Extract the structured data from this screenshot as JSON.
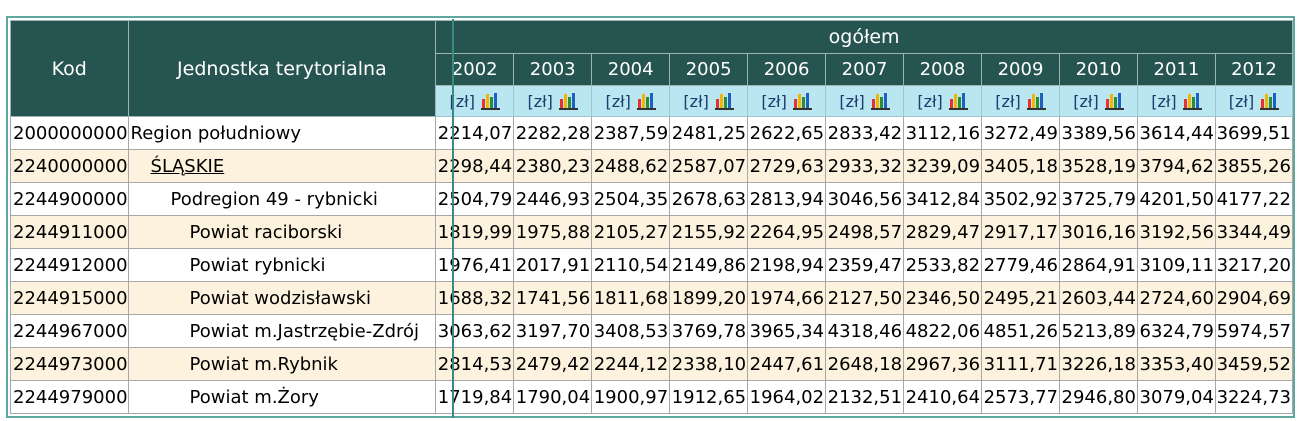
{
  "header": {
    "kod_label": "Kod",
    "jt_label": "Jednostka terytorialna",
    "group_label": "ogółem",
    "years": [
      "2002",
      "2003",
      "2004",
      "2005",
      "2006",
      "2007",
      "2008",
      "2009",
      "2010",
      "2011",
      "2012"
    ],
    "unit_label": "[zł]",
    "chart_icon": "bar-chart-icon"
  },
  "colors": {
    "header_bg": "#265450",
    "unit_row_bg": "#b9e6f0",
    "alt_row_bg": "#fcf2dd",
    "frame": "#5fa8a0"
  },
  "rows": [
    {
      "code": "2000000000",
      "name": "Region południowy",
      "level": 0,
      "link": false,
      "values": [
        "2214,07",
        "2282,28",
        "2387,59",
        "2481,25",
        "2622,65",
        "2833,42",
        "3112,16",
        "3272,49",
        "3389,56",
        "3614,44",
        "3699,51"
      ]
    },
    {
      "code": "2240000000",
      "name": "ŚLĄSKIE",
      "level": 1,
      "link": true,
      "values": [
        "2298,44",
        "2380,23",
        "2488,62",
        "2587,07",
        "2729,63",
        "2933,32",
        "3239,09",
        "3405,18",
        "3528,19",
        "3794,62",
        "3855,26"
      ]
    },
    {
      "code": "2244900000",
      "name": "Podregion 49 - rybnicki",
      "level": 2,
      "link": false,
      "values": [
        "2504,79",
        "2446,93",
        "2504,35",
        "2678,63",
        "2813,94",
        "3046,56",
        "3412,84",
        "3502,92",
        "3725,79",
        "4201,50",
        "4177,22"
      ]
    },
    {
      "code": "2244911000",
      "name": "Powiat raciborski",
      "level": 3,
      "link": false,
      "values": [
        "1819,99",
        "1975,88",
        "2105,27",
        "2155,92",
        "2264,95",
        "2498,57",
        "2829,47",
        "2917,17",
        "3016,16",
        "3192,56",
        "3344,49"
      ]
    },
    {
      "code": "2244912000",
      "name": "Powiat rybnicki",
      "level": 3,
      "link": false,
      "values": [
        "1976,41",
        "2017,91",
        "2110,54",
        "2149,86",
        "2198,94",
        "2359,47",
        "2533,82",
        "2779,46",
        "2864,91",
        "3109,11",
        "3217,20"
      ]
    },
    {
      "code": "2244915000",
      "name": "Powiat wodzisławski",
      "level": 3,
      "link": false,
      "values": [
        "1688,32",
        "1741,56",
        "1811,68",
        "1899,20",
        "1974,66",
        "2127,50",
        "2346,50",
        "2495,21",
        "2603,44",
        "2724,60",
        "2904,69"
      ]
    },
    {
      "code": "2244967000",
      "name": "Powiat m.Jastrzębie-Zdrój",
      "level": 3,
      "link": false,
      "values": [
        "3063,62",
        "3197,70",
        "3408,53",
        "3769,78",
        "3965,34",
        "4318,46",
        "4822,06",
        "4851,26",
        "5213,89",
        "6324,79",
        "5974,57"
      ]
    },
    {
      "code": "2244973000",
      "name": "Powiat m.Rybnik",
      "level": 3,
      "link": false,
      "values": [
        "2814,53",
        "2479,42",
        "2244,12",
        "2338,10",
        "2447,61",
        "2648,18",
        "2967,36",
        "3111,71",
        "3226,18",
        "3353,40",
        "3459,52"
      ]
    },
    {
      "code": "2244979000",
      "name": "Powiat m.Żory",
      "level": 3,
      "link": false,
      "values": [
        "1719,84",
        "1790,04",
        "1900,97",
        "1912,65",
        "1964,02",
        "2132,51",
        "2410,64",
        "2573,77",
        "2946,80",
        "3079,04",
        "3224,73"
      ]
    }
  ]
}
